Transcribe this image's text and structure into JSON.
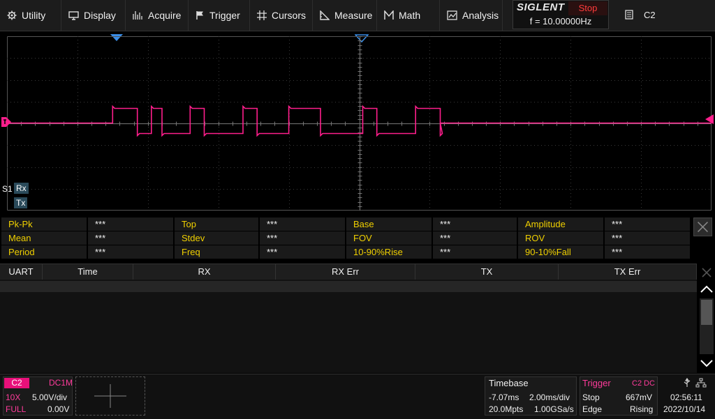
{
  "menu": [
    {
      "label": "Utility",
      "icon": "gear-icon"
    },
    {
      "label": "Display",
      "icon": "monitor-icon"
    },
    {
      "label": "Acquire",
      "icon": "acquire-icon"
    },
    {
      "label": "Trigger",
      "icon": "flag-icon"
    },
    {
      "label": "Cursors",
      "icon": "crosshair-icon"
    },
    {
      "label": "Measure",
      "icon": "ruler-icon"
    },
    {
      "label": "Math",
      "icon": "math-icon"
    },
    {
      "label": "Analysis",
      "icon": "analysis-icon"
    }
  ],
  "brand": {
    "name": "SIGLENT",
    "run_state": "Stop",
    "frequency": "f = 10.00000Hz"
  },
  "trigger_source_top": "C2",
  "serial_labels": {
    "bus": "S1",
    "rx": "Rx",
    "tx": "Tx"
  },
  "measurements": [
    [
      {
        "label": "Pk-Pk",
        "value": "***"
      },
      {
        "label": "Top",
        "value": "***"
      },
      {
        "label": "Base",
        "value": "***"
      },
      {
        "label": "Amplitude",
        "value": "***"
      }
    ],
    [
      {
        "label": "Mean",
        "value": "***"
      },
      {
        "label": "Stdev",
        "value": "***"
      },
      {
        "label": "FOV",
        "value": "***"
      },
      {
        "label": "ROV",
        "value": "***"
      }
    ],
    [
      {
        "label": "Period",
        "value": "***"
      },
      {
        "label": "Freq",
        "value": "***"
      },
      {
        "label": "10-90%Rise",
        "value": "***"
      },
      {
        "label": "90-10%Fall",
        "value": "***"
      }
    ]
  ],
  "decode_columns": [
    "UART",
    "Time",
    "RX",
    "RX Err",
    "TX",
    "TX Err"
  ],
  "channel": {
    "name": "C2",
    "coupling": "DC1M",
    "probe": "10X",
    "scale": "5.00V/div",
    "bandwidth": "FULL",
    "offset": "0.00V"
  },
  "timebase": {
    "title": "Timebase",
    "delay": "-7.07ms",
    "scale": "2.00ms/div",
    "memory": "20.0Mpts",
    "sample_rate": "1.00GSa/s"
  },
  "trigger": {
    "title": "Trigger",
    "source": "C2",
    "coupling": "DC",
    "state": "Stop",
    "level": "667mV",
    "type": "Edge",
    "slope": "Rising"
  },
  "clock": {
    "time": "02:56:11",
    "date": "2022/10/14"
  },
  "colors": {
    "channel": "#ff1e8c",
    "label": "#f0d000",
    "marker": "#3a8ee8"
  },
  "waveform": {
    "edges_ms": [
      -7.0,
      -6.3,
      -5.9,
      -5.6,
      -4.8,
      -4.4,
      -3.3,
      -2.9,
      -2.0,
      -1.1,
      0.1,
      0.5,
      1.6,
      2.3
    ]
  }
}
